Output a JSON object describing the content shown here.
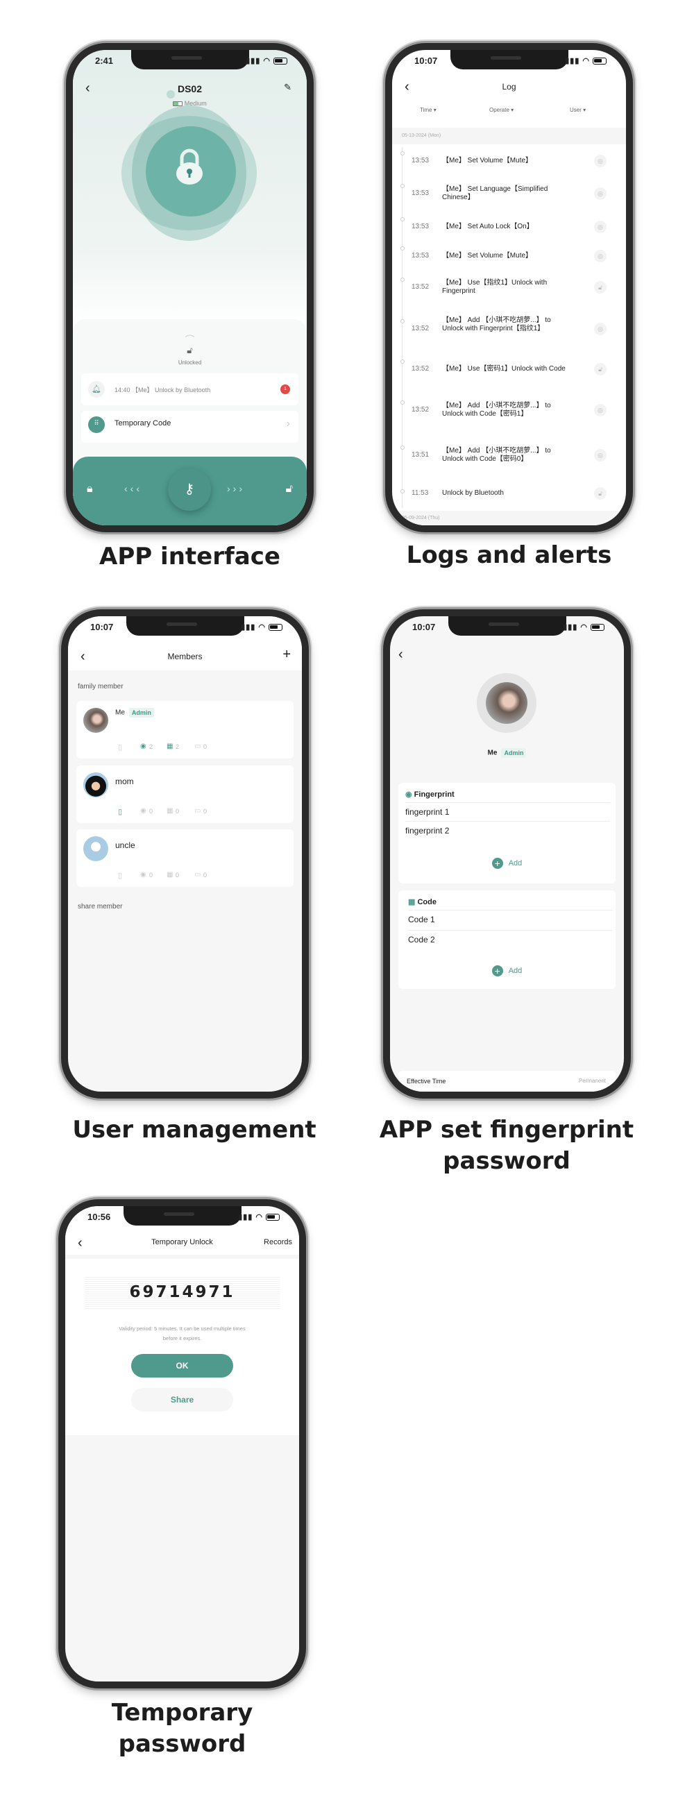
{
  "colors": {
    "accent": "#4f9a8d",
    "badge_bg": "#e6f3ef",
    "alert": "#e24a4a"
  },
  "app_screen": {
    "status_time": "2:41",
    "title": "DS02",
    "battery_label": "Medium",
    "lock_state": "Unlocked",
    "notification": {
      "time": "14:40",
      "text": "【Me】 Unlock by Bluetooth",
      "count": "1"
    },
    "temporary_code_label": "Temporary Code",
    "icons": [
      "back-icon",
      "edit-icon",
      "battery-icon",
      "padlock-icon",
      "bell-icon",
      "keypad-icon",
      "lock-icon",
      "key-icon",
      "unlock-icon"
    ],
    "caption": "APP interface"
  },
  "log_screen": {
    "status_time": "10:07",
    "title": "Log",
    "filters": [
      "Time",
      "Operate",
      "User"
    ],
    "date_header": "05-13-2024 (Mon)",
    "entries": [
      {
        "time": "13:53",
        "text": "【Me】 Set Volume【Mute】",
        "icon": "eye-icon"
      },
      {
        "time": "13:53",
        "text": "【Me】 Set Language【Simplified Chinese】",
        "icon": "eye-icon"
      },
      {
        "time": "13:53",
        "text": "【Me】 Set Auto Lock【On】",
        "icon": "eye-icon"
      },
      {
        "time": "13:53",
        "text": "【Me】 Set Volume【Mute】",
        "icon": "eye-icon"
      },
      {
        "time": "13:52",
        "text": "【Me】 Use【指纹1】Unlock with Fingerprint",
        "icon": "unlock-icon"
      },
      {
        "time": "13:52",
        "text": "【Me】 Add 【小琪不吃胡萝...】 to Unlock with Fingerprint【指纹1】",
        "icon": "eye-icon"
      },
      {
        "time": "13:52",
        "text": "【Me】 Use【密码1】Unlock with Code",
        "icon": "unlock-icon"
      },
      {
        "time": "13:52",
        "text": "【Me】 Add 【小琪不吃胡萝...】 to Unlock with Code【密码1】",
        "icon": "eye-icon"
      },
      {
        "time": "13:51",
        "text": "【Me】 Add 【小琪不吃胡萝...】 to Unlock with Code【密码0】",
        "icon": "eye-icon"
      },
      {
        "time": "11:53",
        "text": "Unlock by Bluetooth",
        "icon": "unlock-icon"
      }
    ],
    "next_date_header": "05-09-2024 (Thu)",
    "caption": "Logs and alerts"
  },
  "members_screen": {
    "status_time": "10:07",
    "title": "Members",
    "family_label": "family member",
    "members": [
      {
        "name": "Me",
        "badge": "Admin",
        "phone": "",
        "fingerprint": "2",
        "code": "2",
        "card": "0"
      },
      {
        "name": "mom",
        "badge": "",
        "phone": "",
        "fingerprint": "0",
        "code": "0",
        "card": "0"
      },
      {
        "name": "uncle",
        "badge": "",
        "phone": "",
        "fingerprint": "0",
        "code": "0",
        "card": "0"
      }
    ],
    "share_label": "share member",
    "caption": "User management"
  },
  "detail_screen": {
    "status_time": "10:07",
    "name": "Me",
    "badge": "Admin",
    "fingerprint_title": "Fingerprint",
    "fingerprints": [
      "fingerprint 1",
      "fingerprint 2"
    ],
    "code_title": "Code",
    "codes": [
      "Code 1",
      "Code 2"
    ],
    "add_label": "Add",
    "effective_label": "Effective Time",
    "effective_value": "Permanent",
    "caption_line1": "APP set fingerprint",
    "caption_line2": "password"
  },
  "temp_screen": {
    "status_time": "10:56",
    "title": "Temporary Unlock",
    "records_label": "Records",
    "code": "69714971",
    "validity_line1": "Validity period: 5 minutes. It can be used multiple times",
    "validity_line2": "before it expires.",
    "ok_label": "OK",
    "share_label": "Share",
    "caption_line1": "Temporary",
    "caption_line2": "password"
  }
}
